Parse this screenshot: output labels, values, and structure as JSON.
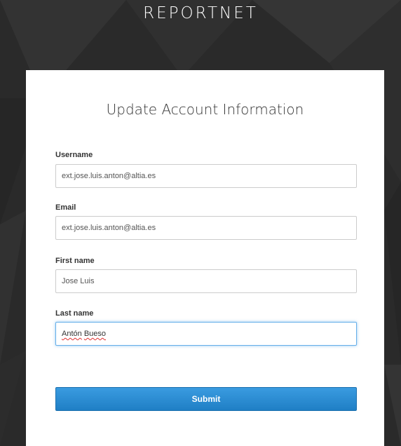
{
  "header": {
    "brand": "REPORTNET"
  },
  "form": {
    "title": "Update Account Information",
    "fields": [
      {
        "label": "Username",
        "value": "ext.jose.luis.anton@altia.es"
      },
      {
        "label": "Email",
        "value": "ext.jose.luis.anton@altia.es"
      },
      {
        "label": "First name",
        "value": "Jose Luis"
      },
      {
        "label": "Last name",
        "value_part1": "Antón",
        "value_part2": "Bueso"
      }
    ],
    "submit_label": "Submit"
  },
  "colors": {
    "background": "#2b2b2b",
    "card": "#ffffff",
    "button": "#1f7fc5",
    "focus_border": "#66afe9"
  },
  "icons": []
}
